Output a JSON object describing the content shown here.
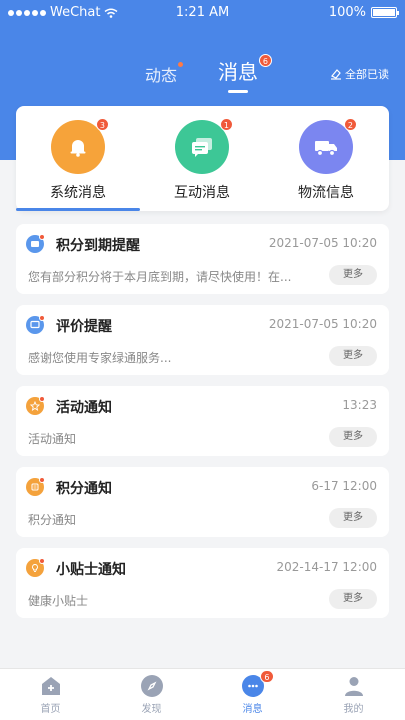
{
  "status_bar": {
    "carrier": "WeChat",
    "time": "1:21 AM",
    "battery": "100%"
  },
  "top_nav": {
    "tab_dynamic": "动态",
    "tab_messages": "消息",
    "messages_badge": "6",
    "mark_all_read": "全部已读"
  },
  "categories": [
    {
      "label": "系统消息",
      "badge": "3",
      "color": "#f6a33a",
      "icon": "bell-icon"
    },
    {
      "label": "互动消息",
      "badge": "1",
      "color": "#3dc796",
      "icon": "chat-icon"
    },
    {
      "label": "物流信息",
      "badge": "2",
      "color": "#7b86f0",
      "icon": "truck-icon"
    }
  ],
  "messages": [
    {
      "title": "积分到期提醒",
      "time": "2021-07-05 10:20",
      "desc": "您有部分积分将于本月底到期，请尽快使用！在...",
      "more": "更多",
      "icon": "points-icon",
      "unread": true
    },
    {
      "title": "评价提醒",
      "time": "2021-07-05 10:20",
      "desc": "感谢您使用专家绿通服务...",
      "more": "更多",
      "icon": "review-icon",
      "unread": true
    },
    {
      "title": "活动通知",
      "time": "13:23",
      "desc": "活动通知",
      "more": "更多",
      "icon": "star-icon",
      "unread": true
    },
    {
      "title": "积分通知",
      "time": "6-17 12:00",
      "desc": "积分通知",
      "more": "更多",
      "icon": "coin-icon",
      "unread": true
    },
    {
      "title": "小贴士通知",
      "time": "202-14-17 12:00",
      "desc": "健康小贴士",
      "more": "更多",
      "icon": "tip-icon",
      "unread": true
    }
  ],
  "tabbar": [
    {
      "label": "首页",
      "icon": "home-icon"
    },
    {
      "label": "发现",
      "icon": "compass-icon"
    },
    {
      "label": "消息",
      "icon": "message-icon",
      "badge": "6",
      "active": true
    },
    {
      "label": "我的",
      "icon": "user-icon"
    }
  ],
  "colors": {
    "primary": "#4a86e8",
    "badge": "#f05a3a"
  }
}
